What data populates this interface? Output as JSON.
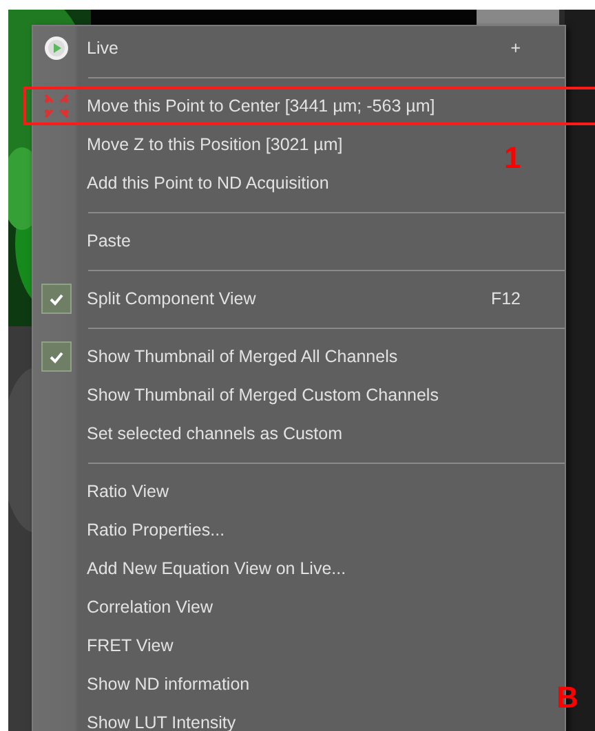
{
  "context_menu": {
    "items": [
      {
        "kind": "item",
        "label": "Live",
        "shortcut": "+",
        "checked": false,
        "highlighted": false
      },
      {
        "kind": "separator"
      },
      {
        "kind": "item",
        "label": "Move this Point to Center [3441 µm; -563 µm]",
        "checked": false,
        "highlighted": true
      },
      {
        "kind": "item",
        "label": "Move Z to this Position [3021 µm]",
        "checked": false,
        "highlighted": false
      },
      {
        "kind": "item",
        "label": "Add this Point to ND Acquisition",
        "checked": false,
        "highlighted": false
      },
      {
        "kind": "separator"
      },
      {
        "kind": "item",
        "label": "Paste",
        "checked": false,
        "highlighted": false
      },
      {
        "kind": "separator"
      },
      {
        "kind": "item",
        "label": "Split Component View",
        "shortcut": "F12",
        "checked": true,
        "highlighted": false
      },
      {
        "kind": "separator"
      },
      {
        "kind": "item",
        "label": "Show Thumbnail of Merged All Channels",
        "checked": true,
        "highlighted": false
      },
      {
        "kind": "item",
        "label": "Show Thumbnail of Merged Custom Channels",
        "checked": false,
        "highlighted": false
      },
      {
        "kind": "item",
        "label": "Set selected channels as Custom",
        "checked": false,
        "highlighted": false
      },
      {
        "kind": "separator"
      },
      {
        "kind": "item",
        "label": "Ratio View",
        "checked": false,
        "highlighted": false
      },
      {
        "kind": "item",
        "label": "Ratio Properties...",
        "checked": false,
        "highlighted": false
      },
      {
        "kind": "item",
        "label": "Add New Equation View on Live...",
        "checked": false,
        "highlighted": false
      },
      {
        "kind": "item",
        "label": "Correlation View",
        "checked": false,
        "highlighted": false
      },
      {
        "kind": "item",
        "label": "FRET View",
        "checked": false,
        "highlighted": false
      },
      {
        "kind": "item",
        "label": "Show ND information",
        "checked": false,
        "highlighted": false
      },
      {
        "kind": "item",
        "label": "Show LUT Intensity",
        "checked": false,
        "highlighted": false
      }
    ]
  },
  "annotations": [
    {
      "text": "1"
    },
    {
      "text": "B"
    }
  ]
}
